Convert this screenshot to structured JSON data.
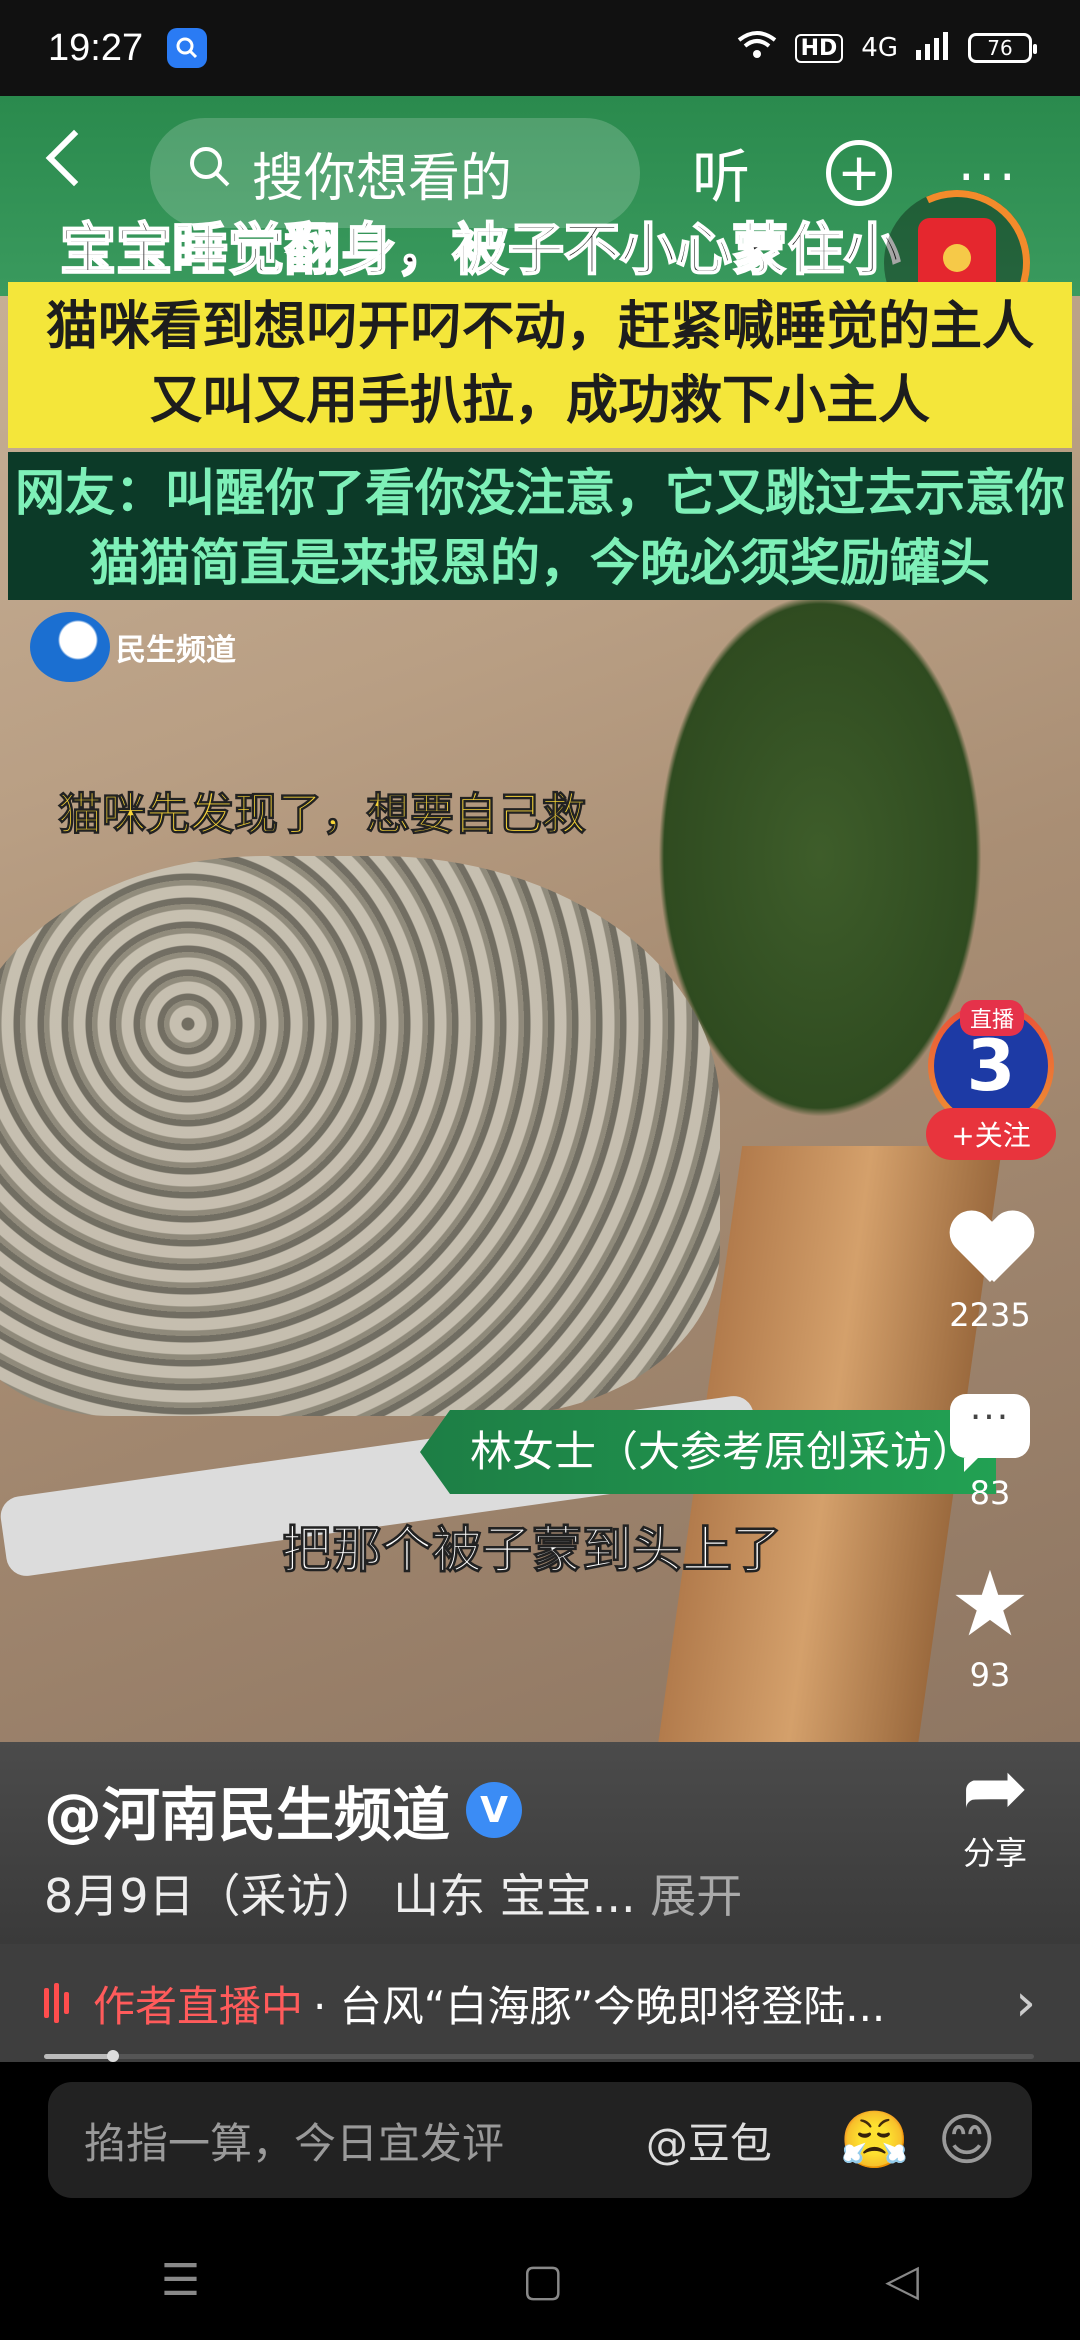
{
  "status_bar": {
    "time": "19:27",
    "hd": "HD",
    "network": "4G",
    "battery": "76"
  },
  "top_bar": {
    "search_placeholder": "搜你想看的",
    "listen_label": "听"
  },
  "overlay": {
    "headline": "宝宝睡觉翻身，被子不小心蒙住小",
    "yellow_line1": "猫咪看到想叼开叼不动，赶紧喊睡觉的主人",
    "yellow_line2": "又叫又用手扒拉，成功救下小主人",
    "dark_line1": "网友：叫醒你了看你没注意，它又跳过去示意你",
    "dark_line2": "猫猫简直是来报恩的，今晚必须奖励罐头",
    "channel_logo": "民生频道",
    "caption1": "猫咪先发现了，想要自己救",
    "interview_tag": "林女士（大参考原创采访）",
    "caption2": "把那个被子蒙到头上了"
  },
  "side": {
    "live_badge": "直播",
    "avatar_text": "3",
    "follow_label": "+关注",
    "likes": "2235",
    "comments": "83",
    "favorites": "93",
    "share_label": "分享"
  },
  "info": {
    "author": "@河南民生频道",
    "verified": "V",
    "desc": "8月9日（采访） 山东 宝宝...",
    "expand": "展开"
  },
  "live_bar": {
    "label": "作者直播中",
    "text": "· 台风“白海豚”今晚即将登陆..."
  },
  "progress": {
    "fraction": 0.07
  },
  "comment": {
    "placeholder": "掐指一算，今日宜发评",
    "mention": "@豆包"
  },
  "colors": {
    "accent_red": "#e8343d",
    "yellow_banner": "#f4e63a",
    "dark_banner": "#0c3a28"
  }
}
